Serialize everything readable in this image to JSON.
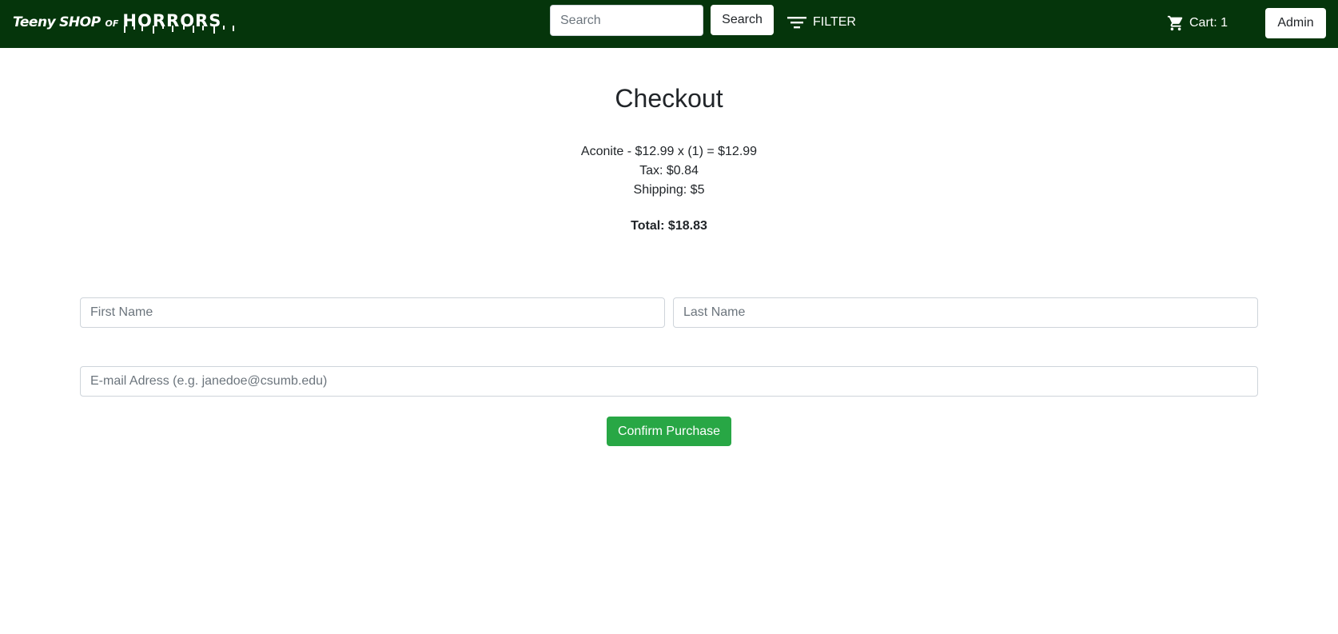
{
  "navbar": {
    "brand": {
      "part1": "Teeny",
      "part2": "SHOP",
      "part3": "OF",
      "part4": "HORRORS"
    },
    "search": {
      "placeholder": "Search",
      "button_label": "Search"
    },
    "filter_label": "FILTER",
    "cart_label": "Cart: 1",
    "admin_label": "Admin",
    "background_color": "#05350b"
  },
  "checkout": {
    "title": "Checkout",
    "line_item": "Aconite - $12.99 x (1) = $12.99",
    "tax": "Tax: $0.84",
    "shipping": "Shipping: $5",
    "total": "Total: $18.83"
  },
  "form": {
    "first_name_placeholder": "First Name",
    "last_name_placeholder": "Last Name",
    "email_placeholder": "E-mail Adress (e.g. janedoe@csumb.edu)",
    "confirm_label": "Confirm Purchase",
    "confirm_color": "#28a745"
  }
}
